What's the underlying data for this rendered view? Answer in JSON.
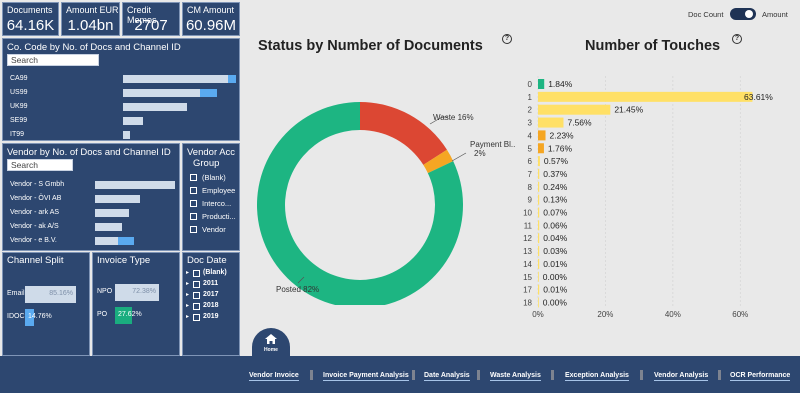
{
  "kpis": [
    {
      "label": "Documents",
      "value": "64.16K"
    },
    {
      "label": "Amount EUR",
      "value": "1.04bn"
    },
    {
      "label": "Credit Memos",
      "value": "2707"
    },
    {
      "label": "CM Amount",
      "value": "60.96M"
    }
  ],
  "company_panel": {
    "title": "Co. Code by No. of Docs and Channel ID",
    "search_placeholder": "Search",
    "rows": [
      {
        "label": "CA99",
        "a": 0.95,
        "b": 0.07
      },
      {
        "label": "US99",
        "a": 0.7,
        "b": 0.15
      },
      {
        "label": "UK99",
        "a": 0.58,
        "b": 0
      },
      {
        "label": "SE99",
        "a": 0.18,
        "b": 0
      },
      {
        "label": "IT99",
        "a": 0.06,
        "b": 0
      }
    ]
  },
  "vendor_panel": {
    "title": "Vendor by No. of Docs and Channel ID",
    "search_placeholder": "Search",
    "rows": [
      {
        "label": "Vendor - S Gmbh",
        "a": 0.98,
        "b": 0
      },
      {
        "label": "Vendor - ÖVI AB",
        "a": 0.55,
        "b": 0
      },
      {
        "label": "Vendor - ark AS",
        "a": 0.42,
        "b": 0
      },
      {
        "label": "Vendor - ak A/S",
        "a": 0.33,
        "b": 0
      },
      {
        "label": "Vendor - e B.V.",
        "a": 0.28,
        "b": 0.2
      }
    ]
  },
  "vendor_acc_group": {
    "title_line1": "Vendor Acc",
    "title_line2": "Group",
    "options": [
      "(Blank)",
      "Employee",
      "Interco...",
      "Producti...",
      "Vendor"
    ]
  },
  "channel_split": {
    "title": "Channel Split",
    "rows": [
      {
        "label": "Email",
        "value": "85.16%",
        "fraction": 0.8516,
        "color": "#cfdbe9"
      },
      {
        "label": "IDOC",
        "value": "14.76%",
        "fraction": 0.1476,
        "color": "#5aaaf0"
      }
    ]
  },
  "invoice_type": {
    "title": "Invoice Type",
    "rows": [
      {
        "label": "NPO",
        "value": "72.38%",
        "fraction": 0.7238,
        "color": "#cfdbe9"
      },
      {
        "label": "PO",
        "value": "27.62%",
        "fraction": 0.2762,
        "color": "#1aad7f"
      }
    ]
  },
  "doc_date": {
    "title": "Doc Date",
    "options": [
      "(Blank)",
      "2011",
      "2017",
      "2018",
      "2019"
    ]
  },
  "toggle": {
    "left_label": "Doc Count",
    "right_label": "Amount",
    "state": "right"
  },
  "chart_data": [
    {
      "type": "pie",
      "title": "Status by Number of Documents",
      "donut": true,
      "slices": [
        {
          "label": "Posted",
          "value": 82,
          "display": "Posted 82%",
          "color": "#1db582"
        },
        {
          "label": "Waste",
          "value": 16,
          "display": "Waste 16%",
          "color": "#dc4733"
        },
        {
          "label": "Payment Bl...",
          "value": 2,
          "display": "Payment Bl...",
          "display2": "2%",
          "color": "#f5a623"
        }
      ]
    },
    {
      "type": "bar",
      "orientation": "horizontal",
      "title": "Number of Touches",
      "categories": [
        "0",
        "1",
        "2",
        "3",
        "4",
        "5",
        "6",
        "7",
        "8",
        "9",
        "10",
        "11",
        "12",
        "13",
        "14",
        "15",
        "17",
        "18"
      ],
      "values": [
        1.84,
        63.61,
        21.45,
        7.56,
        2.23,
        1.76,
        0.57,
        0.37,
        0.24,
        0.13,
        0.07,
        0.06,
        0.04,
        0.03,
        0.01,
        0.0,
        0.01,
        0.0
      ],
      "labels": [
        "1.84%",
        "63.61%",
        "21.45%",
        "7.56%",
        "2.23%",
        "1.76%",
        "0.57%",
        "0.37%",
        "0.24%",
        "0.13%",
        "0.07%",
        "0.06%",
        "0.04%",
        "0.03%",
        "0.01%",
        "0.00%",
        "0.01%",
        "0.00%"
      ],
      "colors": [
        "#1db582",
        "#ffe066",
        "#ffe066",
        "#ffe066",
        "#f5a623",
        "#f5a623",
        "#ffe066",
        "#ffe066",
        "#ffe066",
        "#ffe066",
        "#ffe066",
        "#ffe066",
        "#ffe066",
        "#ffe066",
        "#ffe066",
        "#ffe066",
        "#ffe066",
        "#ffe066"
      ],
      "xticks": [
        "0%",
        "20%",
        "40%",
        "60%"
      ],
      "xlim": [
        0,
        70
      ]
    }
  ],
  "help_icon_glyph": "?",
  "home": {
    "label": "Home",
    "icon": "home-icon"
  },
  "nav": [
    "Vendor Invoice",
    "Invoice Payment Analysis",
    "Date Analysis",
    "Waste Analysis",
    "Exception Analysis",
    "Vendor Analysis",
    "OCR Performance"
  ]
}
